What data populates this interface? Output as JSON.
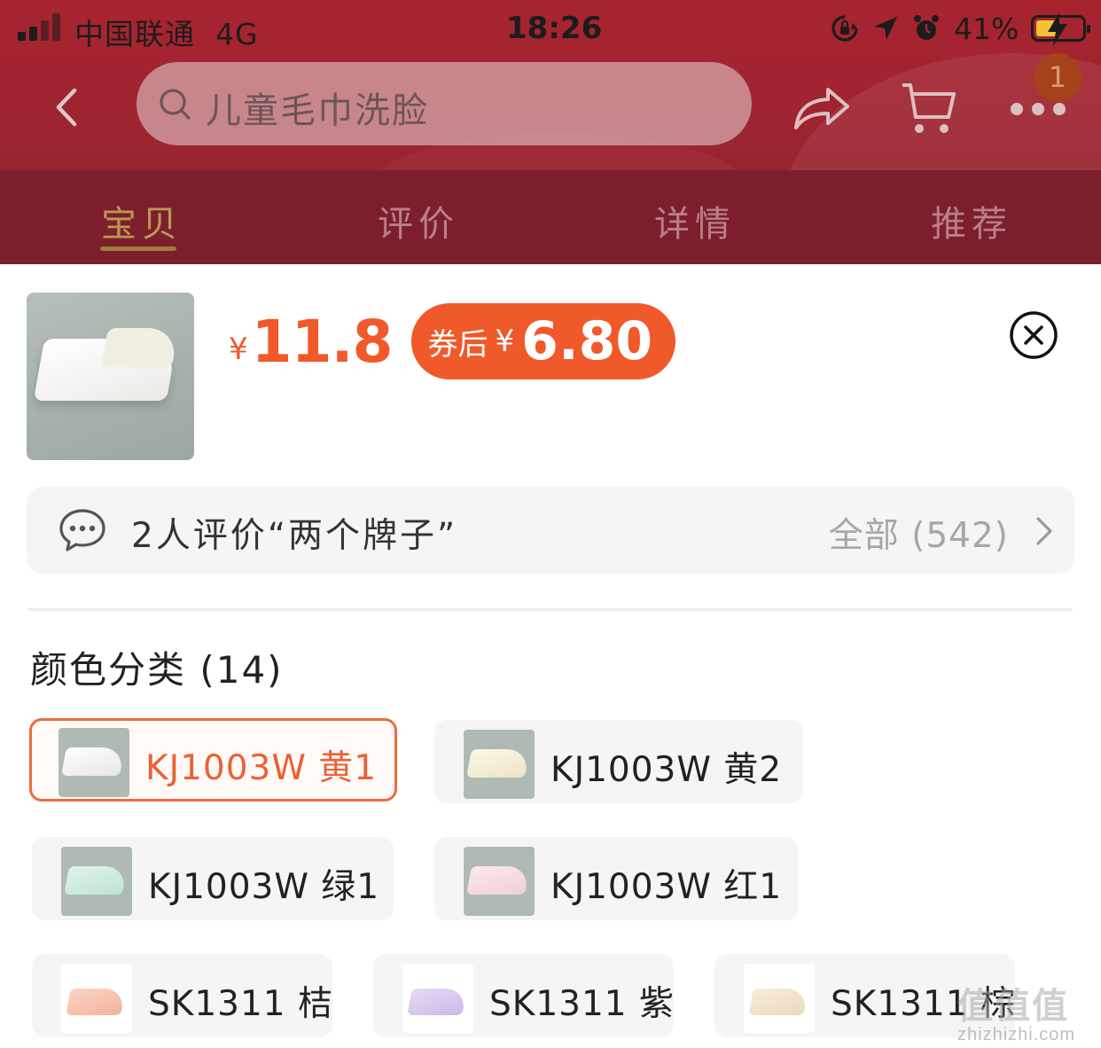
{
  "status_bar": {
    "carrier": "中国联通",
    "network": "4G",
    "time": "18:26",
    "battery": "41%"
  },
  "nav": {
    "search_text": "儿童毛巾洗脸",
    "cart_badge": "1"
  },
  "tabs": [
    {
      "label": "宝贝",
      "active": true
    },
    {
      "label": "评价",
      "active": false
    },
    {
      "label": "详情",
      "active": false
    },
    {
      "label": "推荐",
      "active": false
    }
  ],
  "product": {
    "currency": "¥",
    "price": "11.8",
    "coupon_label": "券后",
    "coupon_currency": "¥",
    "coupon_price": "6.80"
  },
  "review": {
    "summary": "2人评价“两个牌子”",
    "all_label": "全部 (542)"
  },
  "sku": {
    "title": "颜色分类 (14)",
    "options": [
      {
        "label": "KJ1003W 黄1",
        "selected": true
      },
      {
        "label": "KJ1003W 黄2",
        "selected": false
      },
      {
        "label": "KJ1003W 绿1",
        "selected": false
      },
      {
        "label": "KJ1003W 红1",
        "selected": false
      },
      {
        "label": "SK1311 桔",
        "selected": false
      },
      {
        "label": "SK1311 紫",
        "selected": false
      },
      {
        "label": "SK1311 棕",
        "selected": false
      }
    ]
  },
  "watermark": {
    "text": "值值值",
    "url": "zhizhizhi.com"
  },
  "colors": {
    "accent": "#f0592a",
    "tab_active": "#b99a4f",
    "header_bg": "#9e2430"
  }
}
